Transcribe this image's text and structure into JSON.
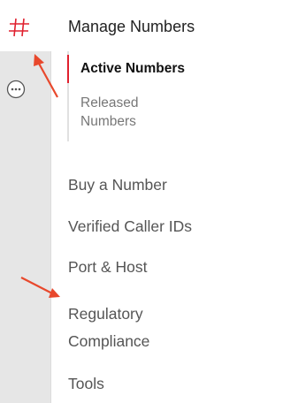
{
  "product_icon": {
    "glyph": "#",
    "color": "#e0202e"
  },
  "more_icon": {
    "glyph": "···"
  },
  "nav": {
    "heading": "Manage Numbers",
    "subitems": [
      {
        "label": "Active Numbers",
        "active": true
      },
      {
        "label": "Released Numbers",
        "active": false
      }
    ],
    "items": [
      {
        "label": "Buy a Number"
      },
      {
        "label": "Verified Caller IDs"
      },
      {
        "label": "Port & Host"
      },
      {
        "label": "Regulatory Compliance"
      },
      {
        "label": "Tools"
      }
    ]
  },
  "colors": {
    "accent": "#e0202e",
    "annotation_arrow": "#e8482c",
    "rail_bg": "#e6e6e6",
    "nav_text": "#555555"
  }
}
